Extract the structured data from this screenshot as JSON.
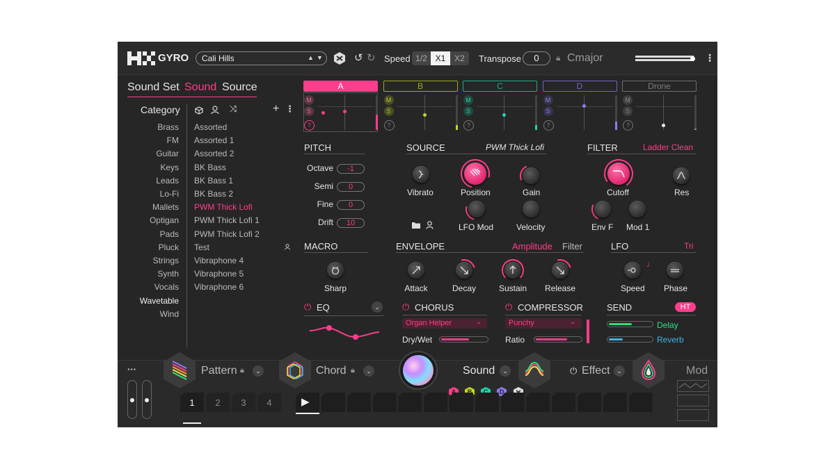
{
  "app": {
    "name": "GYRO"
  },
  "topbar": {
    "preset": "Cali Hills",
    "speed_label": "Speed",
    "speed_options": [
      "1/2",
      "X1",
      "X2"
    ],
    "transpose_label": "Transpose",
    "transpose_value": "0",
    "key_label": "Cmajor"
  },
  "nav_tabs": [
    "Sound Set",
    "Sound",
    "Source"
  ],
  "browser": {
    "category_title": "Category",
    "categories": [
      "Brass",
      "FM",
      "Guitar",
      "Keys",
      "Leads",
      "Lo-Fi",
      "Mallets",
      "Optigan",
      "Pads",
      "Pluck",
      "Strings",
      "Synth",
      "Vocals",
      "Wavetable",
      "Wind"
    ],
    "sounds": [
      "Assorted",
      "Assorted 1",
      "Assorted 2",
      "BK Bass",
      "BK Bass 1",
      "BK Bass 2",
      "PWM Thick Lofi",
      "PWM Thick Lofi 1",
      "PWM Thick Lofi 2",
      "Test",
      "Vibraphone 4",
      "Vibraphone 5",
      "Vibraphone 6"
    ]
  },
  "layers": {
    "tabs": [
      "A",
      "B",
      "C",
      "D",
      "Drone"
    ],
    "mute": "M",
    "solo": "S",
    "random": "?"
  },
  "pitch": {
    "title": "PITCH",
    "rows": [
      {
        "label": "Octave",
        "value": "-1"
      },
      {
        "label": "Semi",
        "value": "0"
      },
      {
        "label": "Fine",
        "value": "0"
      },
      {
        "label": "Drift",
        "value": "10"
      }
    ]
  },
  "source": {
    "title": "SOURCE",
    "preset": "PWM Thick Lofi",
    "knobs": [
      "Vibrato",
      "Position",
      "Gain",
      "LFO Mod",
      "Velocity"
    ]
  },
  "filter": {
    "title": "FILTER",
    "type": "Ladder Clean",
    "knobs": [
      "Cutoff",
      "Res",
      "Env F",
      "Mod 1"
    ]
  },
  "macro": {
    "title": "MACRO",
    "knob": "Sharp"
  },
  "envelope": {
    "title": "ENVELOPE",
    "modes": [
      "Amplitude",
      "Filter"
    ],
    "knobs": [
      "Attack",
      "Decay",
      "Sustain",
      "Release"
    ]
  },
  "lfo": {
    "title": "LFO",
    "shape": "Tri",
    "knobs": [
      "Speed",
      "Phase"
    ]
  },
  "eq": {
    "title": "EQ"
  },
  "chorus": {
    "title": "CHORUS",
    "preset": "Organ Helper",
    "param": "Dry/Wet"
  },
  "compressor": {
    "title": "COMPRESSOR",
    "preset": "Punchy",
    "param": "Ratio"
  },
  "send": {
    "title": "SEND",
    "badge": "HT",
    "items": [
      "Delay",
      "Reverb"
    ]
  },
  "bottom": {
    "more": "···",
    "pattern_label": "Pattern",
    "chord_label": "Chord",
    "sound_label": "Sound",
    "effect_label": "Effect",
    "mod_label": "Mod",
    "layer_chips": [
      "A",
      "B",
      "C",
      "D"
    ],
    "pages": [
      "1",
      "2",
      "3",
      "4"
    ]
  },
  "colors": {
    "accent": "#ff3d8b",
    "layer_b": "#c8d61e",
    "layer_c": "#1ad6b0",
    "layer_d": "#8a7cf0",
    "delay": "#2ee07a",
    "reverb": "#3bb7e8"
  }
}
